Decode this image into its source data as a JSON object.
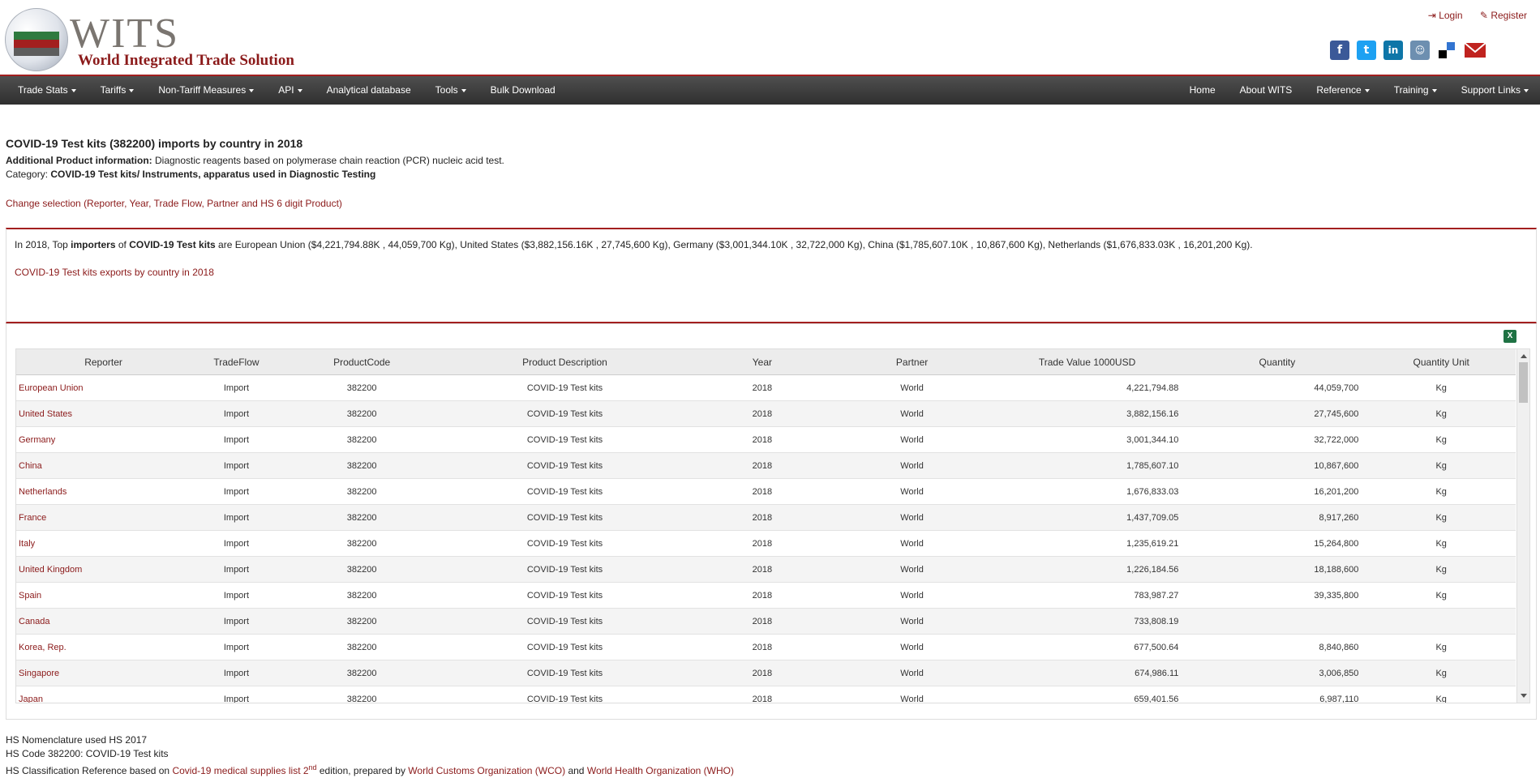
{
  "header": {
    "logo_title": "WITS",
    "logo_subtitle": "World Integrated Trade Solution",
    "login": "Login",
    "register": "Register"
  },
  "nav": {
    "left": [
      "Trade Stats",
      "Tariffs",
      "Non-Tariff Measures",
      "API",
      "Analytical database",
      "Tools",
      "Bulk Download"
    ],
    "right": [
      "Home",
      "About WITS",
      "Reference",
      "Training",
      "Support Links"
    ]
  },
  "page": {
    "title": "COVID-19 Test kits (382200) imports by country in 2018",
    "additional_label": "Additional Product information:",
    "additional_text": "Diagnostic reagents based on polymerase chain reaction (PCR) nucleic acid test.",
    "category_label": "Category:",
    "category_text": "COVID-19 Test kits/ Instruments, apparatus used in Diagnostic Testing",
    "change_selection": "Change selection (Reporter, Year, Trade Flow, Partner and HS 6 digit Product)"
  },
  "summary": {
    "part1": "In 2018, Top ",
    "bold1": "importers",
    "part2": " of ",
    "bold2": "COVID-19 Test kits",
    "part3": " are European Union ($4,221,794.88K , 44,059,700 Kg), United States ($3,882,156.16K , 27,745,600 Kg), Germany ($3,001,344.10K , 32,722,000 Kg), China ($1,785,607.10K , 10,867,600 Kg), Netherlands ($1,676,833.03K , 16,201,200 Kg).",
    "exports_link": "COVID-19 Test kits exports by country in 2018"
  },
  "table": {
    "headers": [
      "Reporter",
      "TradeFlow",
      "ProductCode",
      "Product Description",
      "Year",
      "Partner",
      "Trade Value 1000USD",
      "Quantity",
      "Quantity Unit"
    ],
    "rows": [
      [
        "European Union",
        "Import",
        "382200",
        "COVID-19 Test kits",
        "2018",
        "World",
        "4,221,794.88",
        "44,059,700",
        "Kg"
      ],
      [
        "United States",
        "Import",
        "382200",
        "COVID-19 Test kits",
        "2018",
        "World",
        "3,882,156.16",
        "27,745,600",
        "Kg"
      ],
      [
        "Germany",
        "Import",
        "382200",
        "COVID-19 Test kits",
        "2018",
        "World",
        "3,001,344.10",
        "32,722,000",
        "Kg"
      ],
      [
        "China",
        "Import",
        "382200",
        "COVID-19 Test kits",
        "2018",
        "World",
        "1,785,607.10",
        "10,867,600",
        "Kg"
      ],
      [
        "Netherlands",
        "Import",
        "382200",
        "COVID-19 Test kits",
        "2018",
        "World",
        "1,676,833.03",
        "16,201,200",
        "Kg"
      ],
      [
        "France",
        "Import",
        "382200",
        "COVID-19 Test kits",
        "2018",
        "World",
        "1,437,709.05",
        "8,917,260",
        "Kg"
      ],
      [
        "Italy",
        "Import",
        "382200",
        "COVID-19 Test kits",
        "2018",
        "World",
        "1,235,619.21",
        "15,264,800",
        "Kg"
      ],
      [
        "United Kingdom",
        "Import",
        "382200",
        "COVID-19 Test kits",
        "2018",
        "World",
        "1,226,184.56",
        "18,188,600",
        "Kg"
      ],
      [
        "Spain",
        "Import",
        "382200",
        "COVID-19 Test kits",
        "2018",
        "World",
        "783,987.27",
        "39,335,800",
        "Kg"
      ],
      [
        "Canada",
        "Import",
        "382200",
        "COVID-19 Test kits",
        "2018",
        "World",
        "733,808.19",
        "",
        ""
      ],
      [
        "Korea, Rep.",
        "Import",
        "382200",
        "COVID-19 Test kits",
        "2018",
        "World",
        "677,500.64",
        "8,840,860",
        "Kg"
      ],
      [
        "Singapore",
        "Import",
        "382200",
        "COVID-19 Test kits",
        "2018",
        "World",
        "674,986.11",
        "3,006,850",
        "Kg"
      ],
      [
        "Japan",
        "Import",
        "382200",
        "COVID-19 Test kits",
        "2018",
        "World",
        "659,401.56",
        "6,987,110",
        "Kg"
      ]
    ]
  },
  "footer": {
    "line1": "HS Nomenclature used HS 2017",
    "line2": "HS Code 382200: COVID-19 Test kits",
    "line3_a": "HS Classification Reference based on ",
    "line3_link1": "Covid-19 medical supplies list 2",
    "line3_sup": "nd",
    "line3_b": " edition, prepared by ",
    "line3_link2": "World Customs Organization (WCO)",
    "line3_c": " and ",
    "line3_link3": "World Health Organization (WHO)"
  },
  "icons": [
    "login-icon",
    "register-icon",
    "facebook-icon",
    "twitter-icon",
    "linkedin-icon",
    "reddit-icon",
    "delicious-icon",
    "email-icon",
    "excel-icon"
  ]
}
